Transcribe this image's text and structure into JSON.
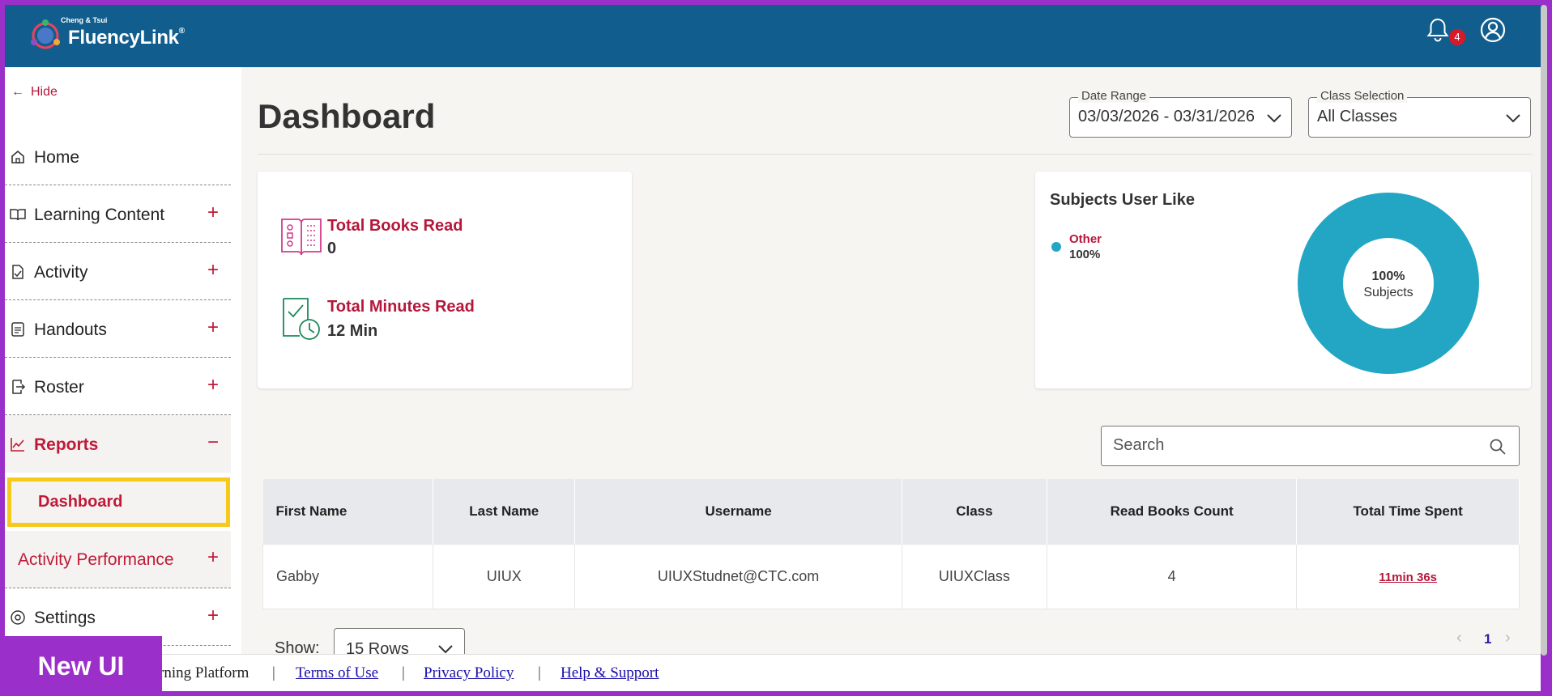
{
  "header": {
    "brand_small": "Cheng & Tsui",
    "brand_name": "FluencyLink",
    "brand_tm": "®",
    "notification_count": "4"
  },
  "sidebar": {
    "hide_label": "Hide",
    "items": [
      {
        "label": "Home"
      },
      {
        "label": "Learning Content",
        "expand": "+"
      },
      {
        "label": "Activity",
        "expand": "+"
      },
      {
        "label": "Handouts",
        "expand": "+"
      },
      {
        "label": "Roster",
        "expand": "+"
      },
      {
        "label": "Reports",
        "expand": "−"
      },
      {
        "label": "Settings",
        "expand": "+"
      }
    ],
    "sub_dashboard": "Dashboard",
    "sub_activity_performance": "Activity Performance",
    "sub_activity_expand": "+"
  },
  "main": {
    "title": "Dashboard",
    "date_range": {
      "caption": "Date Range",
      "value": "03/03/2026 - 03/31/2026"
    },
    "class_selection": {
      "caption": "Class Selection",
      "value": "All Classes"
    },
    "stats": {
      "books_label": "Total Books Read",
      "books_value": "0",
      "minutes_label": "Total Minutes Read",
      "minutes_value": "12 Min"
    },
    "subjects": {
      "title": "Subjects User Like",
      "legend_label": "Other",
      "legend_pct": "100%",
      "center_pct": "100%",
      "center_label": "Subjects",
      "color": "#22a6c4"
    },
    "search_placeholder": "Search",
    "table": {
      "headers": [
        "First Name",
        "Last Name",
        "Username",
        "Class",
        "Read Books Count",
        "Total Time Spent"
      ],
      "rows": [
        [
          "Gabby",
          "UIUX",
          "UIUXStudnet@CTC.com",
          "UIUXClass",
          "4",
          "11min 36s"
        ]
      ]
    },
    "show_label": "Show:",
    "rows_value": "15 Rows",
    "page": "1"
  },
  "footer": {
    "platform_text": "rning Platform",
    "sep": "|",
    "terms": "Terms of Use",
    "privacy": "Privacy Policy",
    "help": "Help & Support"
  },
  "overlay_label": "New UI"
}
